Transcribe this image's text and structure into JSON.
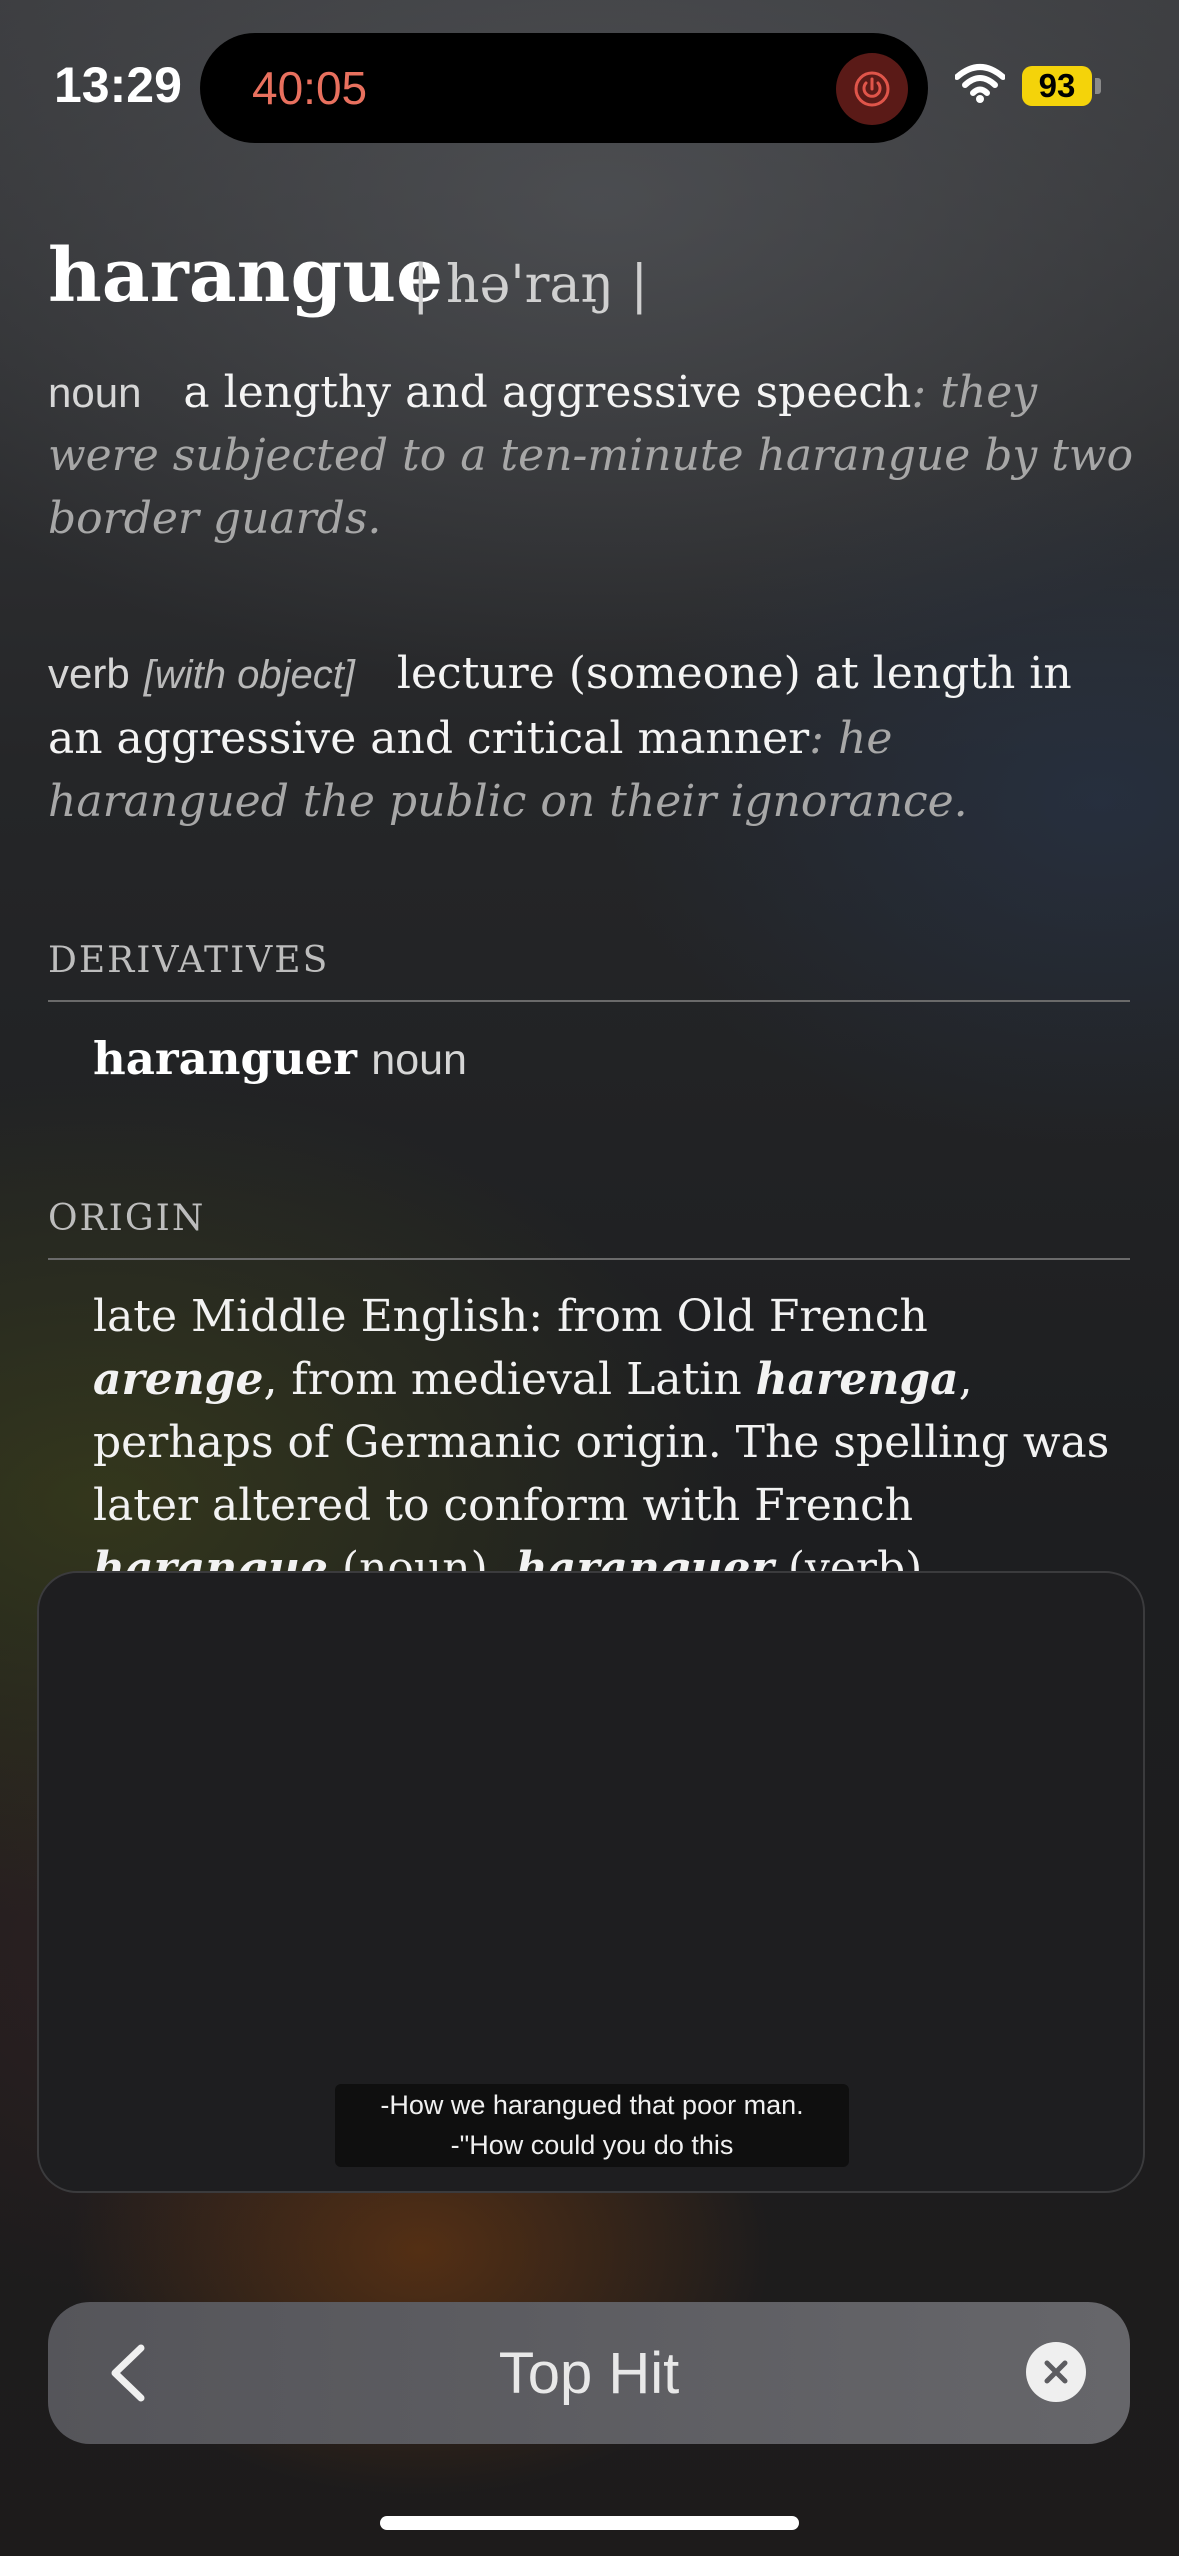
{
  "status": {
    "time": "13:29",
    "timer": "40:05",
    "battery": "93"
  },
  "entry": {
    "headword": "harangue",
    "pronunciation": "| hə'raŋ |",
    "noun": {
      "pos": "noun",
      "definition": "a lengthy and aggressive speech",
      "colon": ":",
      "example": "they were subjected to a ten-minute harangue by two border guards."
    },
    "verb": {
      "pos": "verb",
      "grammar": "[with object]",
      "definition": "lecture (someone) at length in an aggressive and critical manner",
      "colon": ":",
      "example": "he harangued the public on their ignorance."
    },
    "derivatives": {
      "title": "DERIVATIVES",
      "word": "haranguer",
      "pos": "noun"
    },
    "origin": {
      "title": "ORIGIN",
      "t1": "late Middle English: from Old French ",
      "w1": "arenge",
      "t2": ", from medieval Latin ",
      "w2": "harenga",
      "t3": ", perhaps of Germanic origin. The spelling was later altered to conform with French ",
      "w3": "harangue",
      "t4": " (noun), ",
      "w4": "haranguer",
      "t5": " (verb)."
    }
  },
  "video": {
    "caption_line1": "-How we harangued that poor man.",
    "caption_line2": "-\"How could you do this"
  },
  "searchbar": {
    "label": "Top Hit"
  }
}
